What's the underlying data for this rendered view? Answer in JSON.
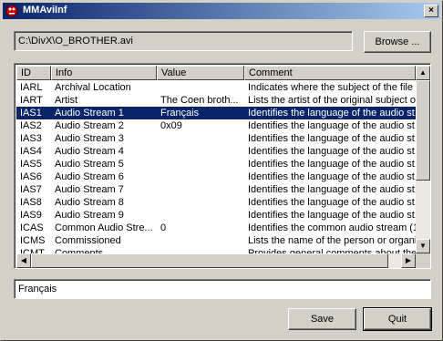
{
  "window": {
    "title": "MMAviInf",
    "close_glyph": "×"
  },
  "file": {
    "path": "C:\\DivX\\O_BROTHER.avi",
    "browse_label": "Browse ..."
  },
  "list": {
    "columns": [
      "ID",
      "Info",
      "Value",
      "Comment"
    ],
    "selected_index": 2,
    "rows": [
      {
        "id": "IARL",
        "info": "Archival Location",
        "value": "",
        "comment": "Indicates where the subject of the file ..."
      },
      {
        "id": "IART",
        "info": "Artist",
        "value": "The Coen broth...",
        "comment": "Lists the artist of the original subject of..."
      },
      {
        "id": "IAS1",
        "info": "Audio Stream 1",
        "value": "Français",
        "comment": "Identifies the language of the audio st..."
      },
      {
        "id": "IAS2",
        "info": "Audio Stream 2",
        "value": "0x09",
        "comment": "Identifies the language of the audio st..."
      },
      {
        "id": "IAS3",
        "info": "Audio Stream 3",
        "value": "",
        "comment": "Identifies the language of the audio st..."
      },
      {
        "id": "IAS4",
        "info": "Audio Stream 4",
        "value": "",
        "comment": "Identifies the language of the audio st..."
      },
      {
        "id": "IAS5",
        "info": "Audio Stream 5",
        "value": "",
        "comment": "Identifies the language of the audio st..."
      },
      {
        "id": "IAS6",
        "info": "Audio Stream 6",
        "value": "",
        "comment": "Identifies the language of the audio st..."
      },
      {
        "id": "IAS7",
        "info": "Audio Stream 7",
        "value": "",
        "comment": "Identifies the language of the audio st..."
      },
      {
        "id": "IAS8",
        "info": "Audio Stream 8",
        "value": "",
        "comment": "Identifies the language of the audio st..."
      },
      {
        "id": "IAS9",
        "info": "Audio Stream 9",
        "value": "",
        "comment": "Identifies the language of the audio st..."
      },
      {
        "id": "ICAS",
        "info": "Common Audio Stre...",
        "value": "0",
        "comment": "Identifies the common audio stream (1..."
      },
      {
        "id": "ICMS",
        "info": "Commissioned",
        "value": "",
        "comment": "Lists the name of the person or organi..."
      },
      {
        "id": "ICMT",
        "info": "Comments",
        "value": "",
        "comment": "Provides general comments about the ..."
      }
    ]
  },
  "scrollbar": {
    "up": "▲",
    "down": "▼",
    "left": "◀",
    "right": "▶"
  },
  "edit": {
    "value": "Français"
  },
  "buttons": {
    "save": "Save",
    "quit": "Quit"
  },
  "colors": {
    "selection": "#0a246a",
    "face": "#d4d0c8"
  }
}
